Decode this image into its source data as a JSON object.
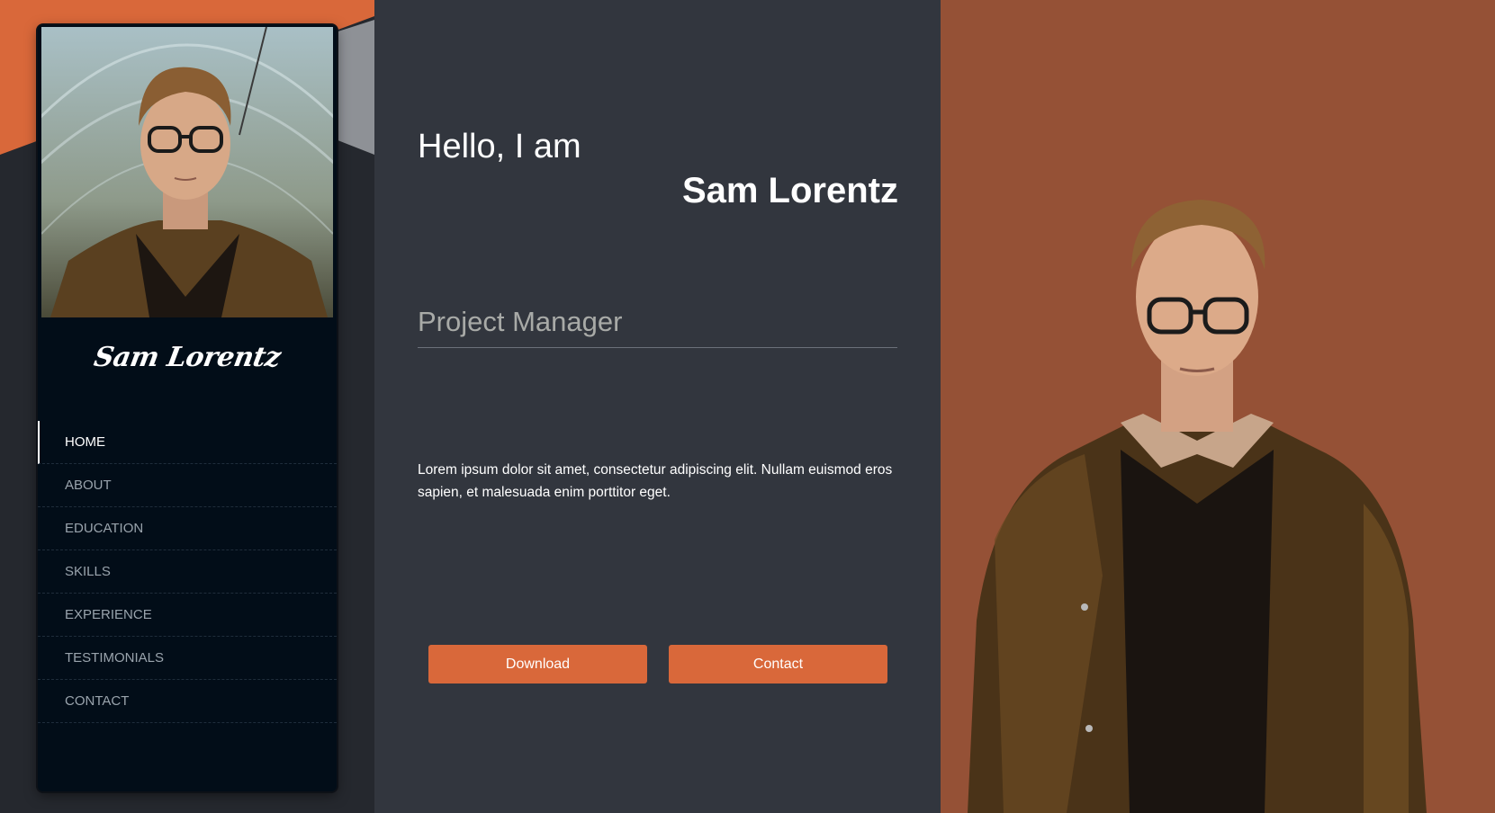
{
  "sidebar": {
    "photo_alt": "profile-photo",
    "signature": "Sam Lorentz",
    "nav": [
      {
        "label": "HOME",
        "active": true
      },
      {
        "label": "ABOUT",
        "active": false
      },
      {
        "label": "EDUCATION",
        "active": false
      },
      {
        "label": "SKILLS",
        "active": false
      },
      {
        "label": "EXPERIENCE",
        "active": false
      },
      {
        "label": "TESTIMONIALS",
        "active": false
      },
      {
        "label": "CONTACT",
        "active": false
      }
    ]
  },
  "hero": {
    "greeting": "Hello, I am",
    "name": "Sam Lorentz",
    "role": "Project Manager",
    "bio": "Lorem ipsum dolor sit amet, consectetur adipiscing elit. Nullam euismod eros sapien, et malesuada enim porttitor eget.",
    "download_label": "Download",
    "contact_label": "Contact"
  },
  "colors": {
    "accent": "#d9683a",
    "panel_right": "#955136",
    "panel_main": "#32363e",
    "sidebar": "#020d18"
  }
}
